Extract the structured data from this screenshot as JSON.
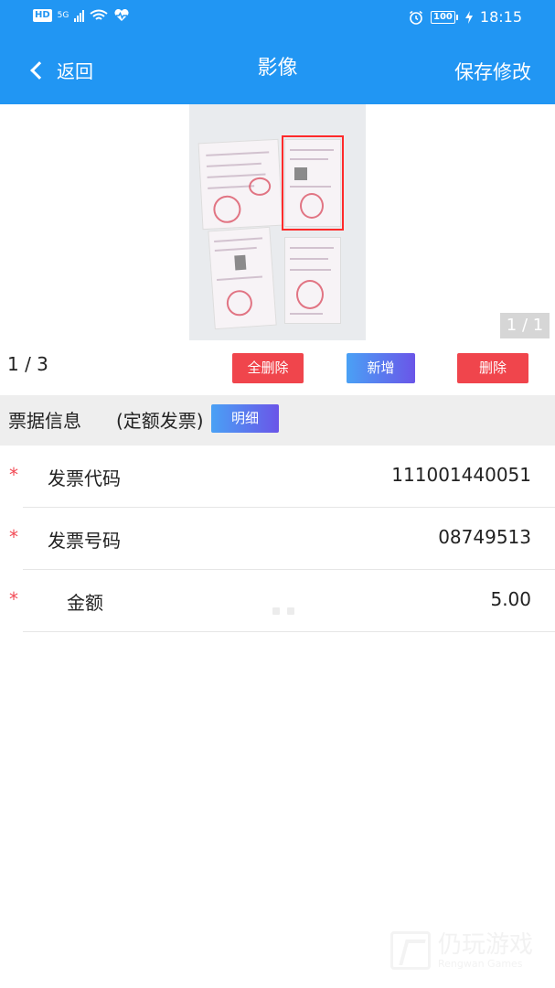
{
  "status_bar": {
    "network": "HD",
    "signal_type": "5G",
    "battery": "100",
    "time": "18:15",
    "icons": [
      "hd-icon",
      "signal-icon",
      "wifi-icon",
      "heart-icon",
      "alarm-icon",
      "battery-icon",
      "charging-icon"
    ]
  },
  "nav": {
    "back_label": "返回",
    "title": "影像",
    "save_label": "保存修改"
  },
  "image_viewer": {
    "page_badge": "1 / 1"
  },
  "actions": {
    "page_count": "1 / 3",
    "delete_all_label": "全删除",
    "add_label": "新增",
    "delete_label": "删除"
  },
  "section": {
    "title": "票据信息",
    "subtitle": "(定额发票)",
    "detail_label": "明细"
  },
  "fields": [
    {
      "label": "发票代码",
      "value": "111001440051",
      "required": "*"
    },
    {
      "label": "发票号码",
      "value": "08749513",
      "required": "*"
    },
    {
      "label": "金额",
      "value": "5.00",
      "required": "*"
    }
  ],
  "watermark": {
    "zh": "仍玩游戏",
    "en": "Rengwan Games"
  },
  "colors": {
    "primary": "#2196f3",
    "danger": "#f0454c",
    "accent_gradient_start": "#4aa1f5",
    "accent_gradient_end": "#6a55e8",
    "required": "#f24a55"
  }
}
